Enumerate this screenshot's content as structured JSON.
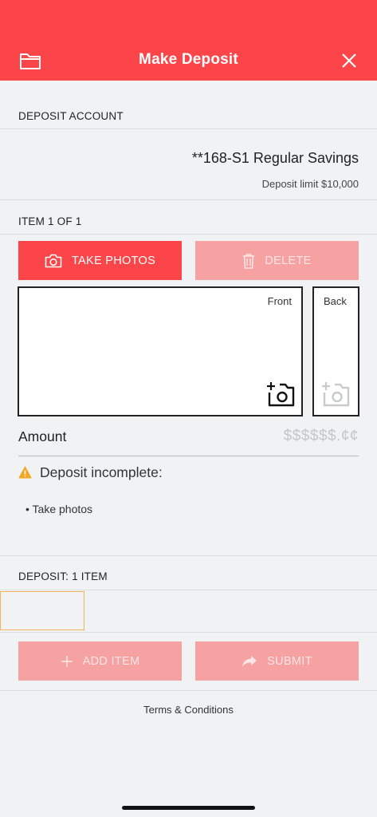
{
  "colors": {
    "brand": "#fc4548",
    "brand_disabled": "#f6a1a2",
    "warning": "#f5a623",
    "thumb_border": "#f2b35a"
  },
  "header": {
    "title": "Make Deposit",
    "left_icon": "folder-icon",
    "right_icon": "close-icon"
  },
  "deposit_account": {
    "section_label": "DEPOSIT ACCOUNT",
    "account_name": "**168-S1 Regular Savings",
    "limit_text": "Deposit limit $10,000"
  },
  "item": {
    "section_label": "ITEM 1 OF 1",
    "take_photos_label": "TAKE PHOTOS",
    "delete_label": "DELETE",
    "front_label": "Front",
    "back_label": "Back",
    "amount_label": "Amount",
    "amount_placeholder": "$$$$$$.¢¢"
  },
  "status": {
    "message": "Deposit incomplete:",
    "tasks": [
      "Take photos"
    ]
  },
  "deposit_summary": {
    "section_label": "DEPOSIT: 1 ITEM"
  },
  "actions": {
    "add_item_label": "ADD ITEM",
    "submit_label": "SUBMIT"
  },
  "footer": {
    "terms_label": "Terms & Conditions"
  }
}
